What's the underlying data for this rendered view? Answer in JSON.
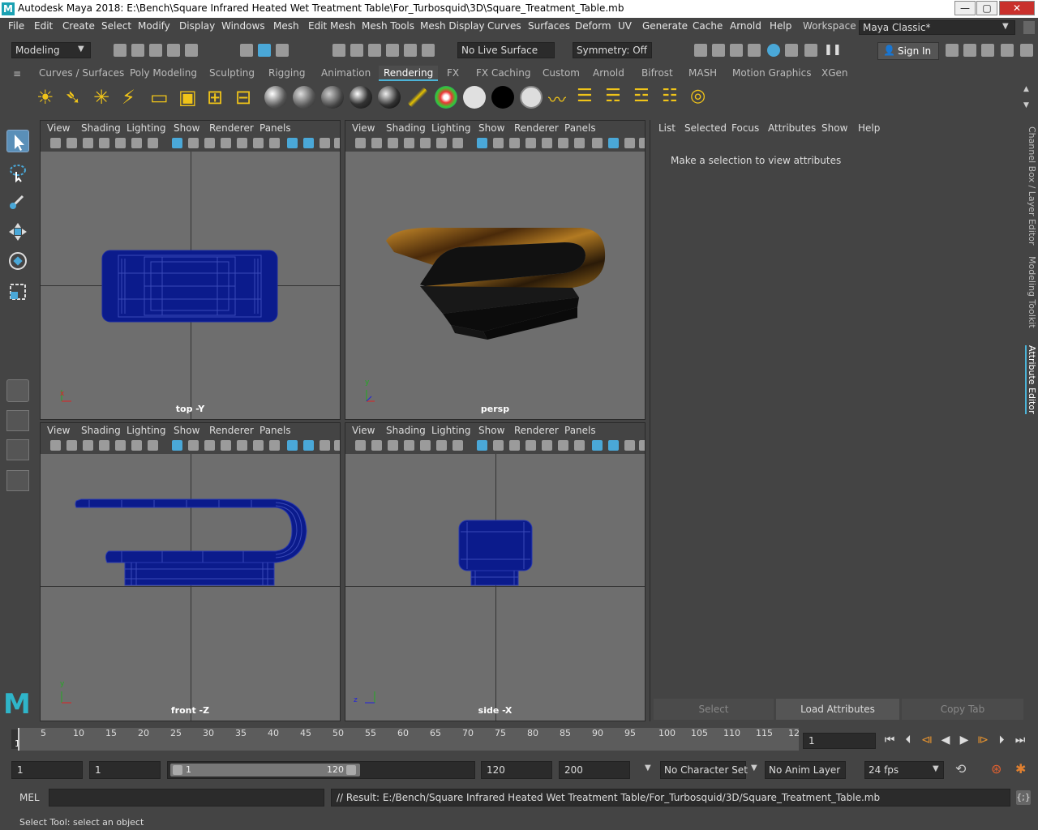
{
  "window": {
    "title": "Autodesk Maya 2018: E:\\Bench\\Square Infrared Heated Wet Treatment Table\\For_Turbosquid\\3D\\Square_Treatment_Table.mb",
    "minimize": "—",
    "maximize": "▢",
    "close": "✕"
  },
  "menubar": {
    "items": [
      "File",
      "Edit",
      "Create",
      "Select",
      "Modify",
      "Display",
      "Windows",
      "Mesh",
      "Edit Mesh",
      "Mesh Tools",
      "Mesh Display",
      "Curves",
      "Surfaces",
      "Deform",
      "UV",
      "Generate",
      "Cache",
      "Arnold",
      "Help"
    ],
    "workspace_label": "Workspace :",
    "workspace_value": "Maya Classic*"
  },
  "statusline": {
    "mode": "Modeling",
    "live_surface": "No Live Surface",
    "symmetry": "Symmetry: Off",
    "sign_in": "Sign In"
  },
  "shelf": {
    "tabs": [
      "Curves / Surfaces",
      "Poly Modeling",
      "Sculpting",
      "Rigging",
      "Animation",
      "Rendering",
      "FX",
      "FX Caching",
      "Custom",
      "Arnold",
      "Bifrost",
      "MASH",
      "Motion Graphics",
      "XGen"
    ],
    "active_tab": "Rendering"
  },
  "viewport_menu": [
    "View",
    "Shading",
    "Lighting",
    "Show",
    "Renderer",
    "Panels"
  ],
  "viewports": {
    "top": "top -Y",
    "persp": "persp",
    "front": "front -Z",
    "side": "side -X"
  },
  "axes": {
    "x": "x",
    "y": "y",
    "z": "z"
  },
  "attribute_editor": {
    "menu": [
      "List",
      "Selected",
      "Focus",
      "Attributes",
      "Show",
      "Help"
    ],
    "message": "Make a selection to view attributes",
    "buttons": {
      "select": "Select",
      "load": "Load Attributes",
      "copy": "Copy Tab"
    }
  },
  "side_tabs": [
    "Channel Box / Layer Editor",
    "Modeling Toolkit",
    "Attribute Editor"
  ],
  "timeline": {
    "ticks": [
      "1",
      "5",
      "10",
      "15",
      "20",
      "25",
      "30",
      "35",
      "40",
      "45",
      "50",
      "55",
      "60",
      "65",
      "70",
      "75",
      "80",
      "85",
      "90",
      "95",
      "100",
      "105",
      "110",
      "115",
      "12"
    ],
    "current_frame": "1"
  },
  "range": {
    "start": "1",
    "playback_start": "1",
    "slider_start": "1",
    "slider_end": "120",
    "playback_end": "120",
    "end": "200",
    "character_set": "No Character Set",
    "anim_layer": "No Anim Layer",
    "fps": "24 fps"
  },
  "command": {
    "language": "MEL",
    "result": "// Result: E:/Bench/Square Infrared Heated Wet Treatment Table/For_Turbosquid/3D/Square_Treatment_Table.mb"
  },
  "help_line": "Select Tool: select an object",
  "colors": {
    "accent": "#4cb4d8",
    "wire": "#0b1b8c",
    "bg": "#444444"
  }
}
